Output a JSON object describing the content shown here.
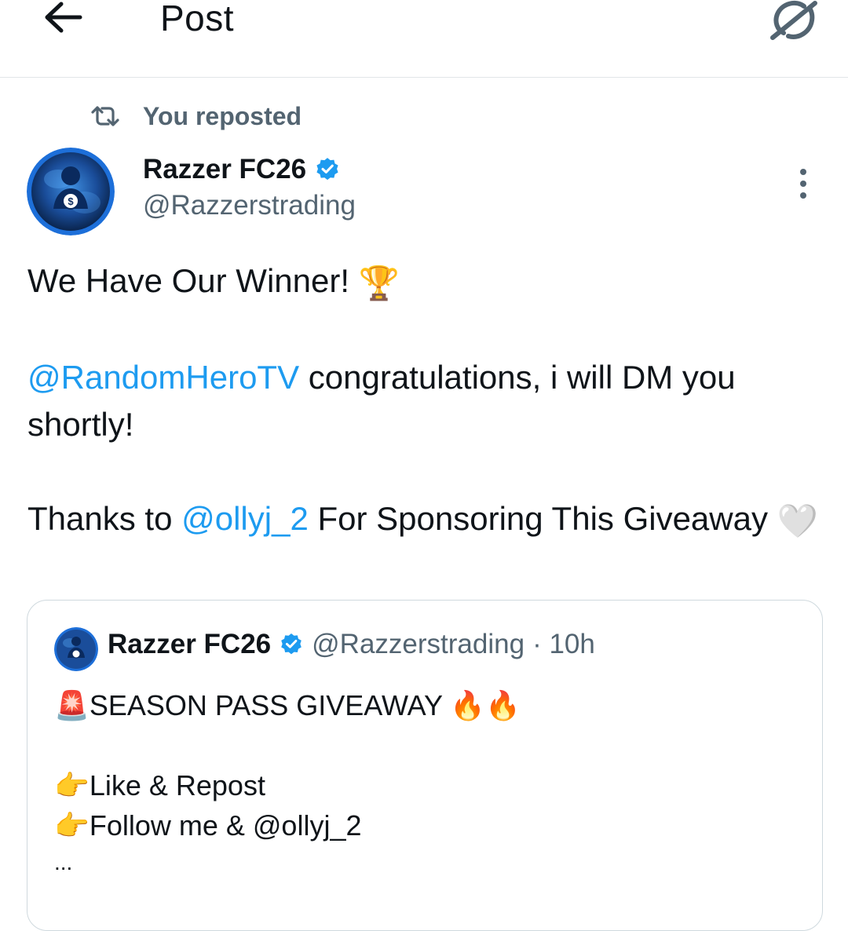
{
  "header": {
    "title": "Post",
    "back_icon": "arrow-left-icon",
    "grok_icon": "grok-icon"
  },
  "repost_context": {
    "icon": "repost-icon",
    "label": "You reposted"
  },
  "post": {
    "author_name": "Razzer FC26",
    "author_handle": "@Razzerstrading",
    "verified": true,
    "line1_text": "We Have Our Winner! ",
    "line1_emoji": "🏆",
    "line2_mention": "@RandomHeroTV",
    "line2_text": " congratulations, i will DM you shortly!",
    "line3_text_before": "Thanks to ",
    "line3_mention": "@ollyj_2",
    "line3_text_after": " For Sponsoring This Giveaway ",
    "line3_emoji": "🤍"
  },
  "quoted_post": {
    "author_name": "Razzer FC26",
    "author_handle": "@Razzerstrading",
    "time": "· 10h",
    "line1_emoji": "🚨",
    "line1_text": "SEASON PASS GIVEAWAY ",
    "line1_trailing_emoji": "🔥🔥",
    "line2_emoji": "👉",
    "line2_text": "Like & Repost",
    "line3_emoji": "👉",
    "line3_text": "Follow me & @ollyj_2",
    "ellipsis": "..."
  },
  "colors": {
    "accent": "#1d9bf0",
    "secondary_text": "#536471",
    "border": "#cfd9de"
  }
}
